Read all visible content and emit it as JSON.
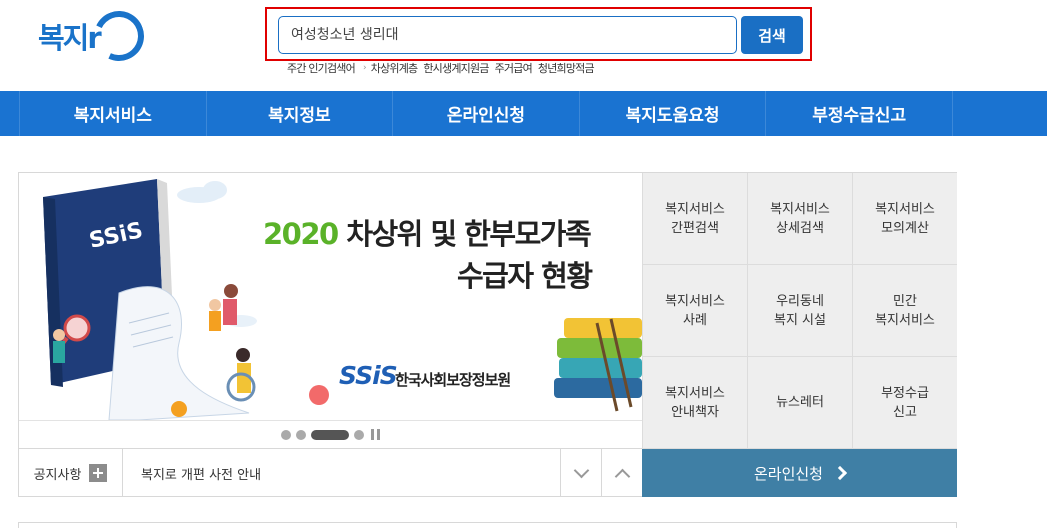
{
  "logo": {
    "text": "복지r"
  },
  "search": {
    "value": "여성청소년 생리대",
    "button_label": "검색"
  },
  "popular": {
    "label": "주간 인기검색어",
    "words": [
      "차상위계층",
      "한시생계지원금",
      "주거급여",
      "청년희망적금"
    ]
  },
  "nav": {
    "items": [
      "복지서비스",
      "복지정보",
      "온라인신청",
      "복지도움요청",
      "부정수급신고"
    ]
  },
  "banner": {
    "year": "2020",
    "title_rest": " 차상위 및 한부모가족",
    "title_line2": "수급자 현황",
    "org_logo": "SSiS",
    "org_name": "한국사회보장정보원",
    "book_label": "SSiS"
  },
  "slider": {
    "dot_count": 4,
    "active_index": 2
  },
  "notice": {
    "label": "공지사항",
    "text": "복지로 개편 사전 안내"
  },
  "quick_menu": [
    "복지서비스\n간편검색",
    "복지서비스\n상세검색",
    "복지서비스\n모의계산",
    "복지서비스\n사례",
    "우리동네\n복지 시설",
    "민간\n복지서비스",
    "복지서비스\n안내책자",
    "뉴스레터",
    "부정수급\n신고"
  ],
  "apply_bar": {
    "label": "온라인신청"
  },
  "colors": {
    "brand": "#1a73d1",
    "highlight": "#e00000",
    "apply": "#3f7fa5",
    "green": "#5ab229"
  }
}
